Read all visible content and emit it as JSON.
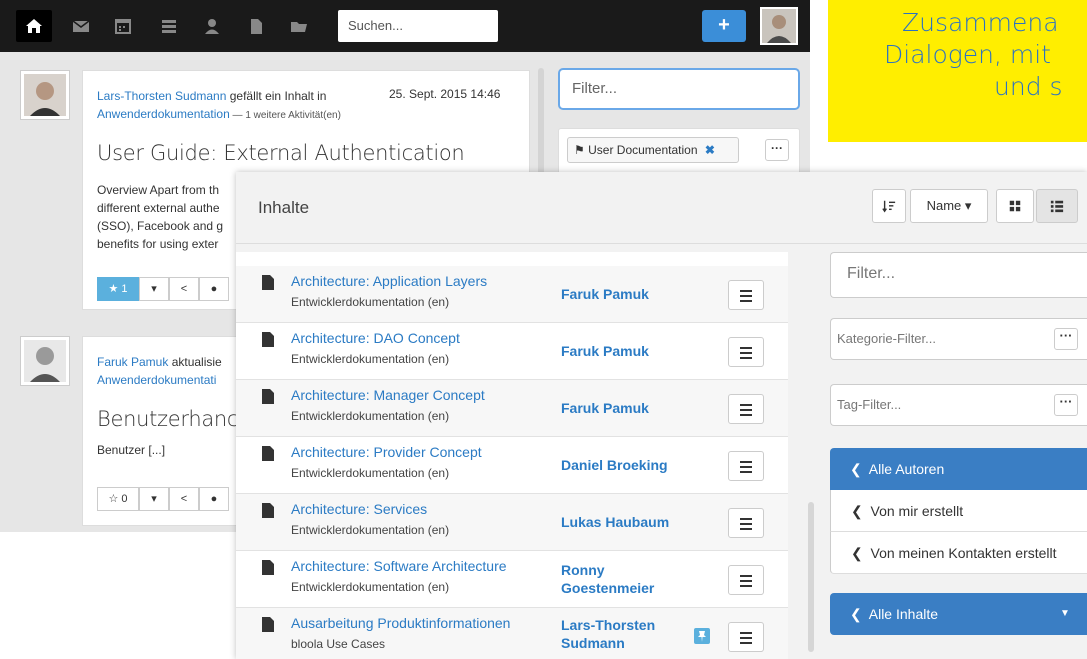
{
  "topbar": {
    "search_placeholder": "Suchen...",
    "plus_label": "+",
    "icons": [
      "home-icon",
      "mail-icon",
      "calendar-icon",
      "list-icon",
      "user-icon",
      "document-icon",
      "folder-icon"
    ]
  },
  "feed": {
    "post1": {
      "author": "Lars-Thorsten Sudmann",
      "action": " gefällt ein Inhalt in",
      "location": "Anwenderdokumentation",
      "more": " — 1 weitere Aktivität(en)",
      "date": "25. Sept. 2015 14:46",
      "title": "User Guide: External Authentication",
      "excerpt": [
        "Overview Apart from th",
        "different external authe",
        "(SSO), Facebook and g",
        "benefits for using exter"
      ],
      "like_count": "1"
    },
    "post2": {
      "author": "Faruk Pamuk",
      "action": " aktualisie",
      "location": "Anwenderdokumentati",
      "title": "Benutzerhanc",
      "excerpt": "Benutzer [...]",
      "like_count": "0"
    }
  },
  "right_panel": {
    "filter_placeholder": "Filter...",
    "tag": "User Documentation",
    "tag_remove": "✖",
    "more": "···"
  },
  "note": {
    "lines": [
      "Zusammena",
      "Dialogen, mit",
      "und s"
    ]
  },
  "modal": {
    "title": "Inhalte",
    "sort_label": "Name",
    "rows": [
      {
        "title": "Architecture: Application Layers",
        "category": "Entwicklerdokumentation (en)",
        "author": "Faruk Pamuk",
        "pinned": false
      },
      {
        "title": "Architecture: DAO Concept",
        "category": "Entwicklerdokumentation (en)",
        "author": "Faruk Pamuk",
        "pinned": false
      },
      {
        "title": "Architecture: Manager Concept",
        "category": "Entwicklerdokumentation (en)",
        "author": "Faruk Pamuk",
        "pinned": false
      },
      {
        "title": "Architecture: Provider Concept",
        "category": "Entwicklerdokumentation (en)",
        "author": "Daniel Broeking",
        "pinned": false
      },
      {
        "title": "Architecture: Services",
        "category": "Entwicklerdokumentation (en)",
        "author": "Lukas Haubaum",
        "pinned": false
      },
      {
        "title": "Architecture: Software Architecture",
        "category": "Entwicklerdokumentation (en)",
        "author": "Ronny Goestenmeier",
        "pinned": false
      },
      {
        "title": "Ausarbeitung Produktinformationen",
        "category": "bloola Use Cases",
        "author": "Lars-Thorsten Sudmann",
        "pinned": true
      }
    ],
    "sidebar": {
      "filter_placeholder": "Filter...",
      "category_filter": "Kategorie-Filter...",
      "tag_filter": "Tag-Filter...",
      "more": "···",
      "all_authors": "Alle Autoren",
      "created_by_me": "Von mir erstellt",
      "created_by_contacts": "Von meinen Kontakten erstellt",
      "all_contents": "Alle Inhalte"
    }
  },
  "colors": {
    "accent": "#3a7ec4",
    "link": "#2b7bc4",
    "note_bg": "#ffee00",
    "topbar": "#1a1a1a"
  }
}
